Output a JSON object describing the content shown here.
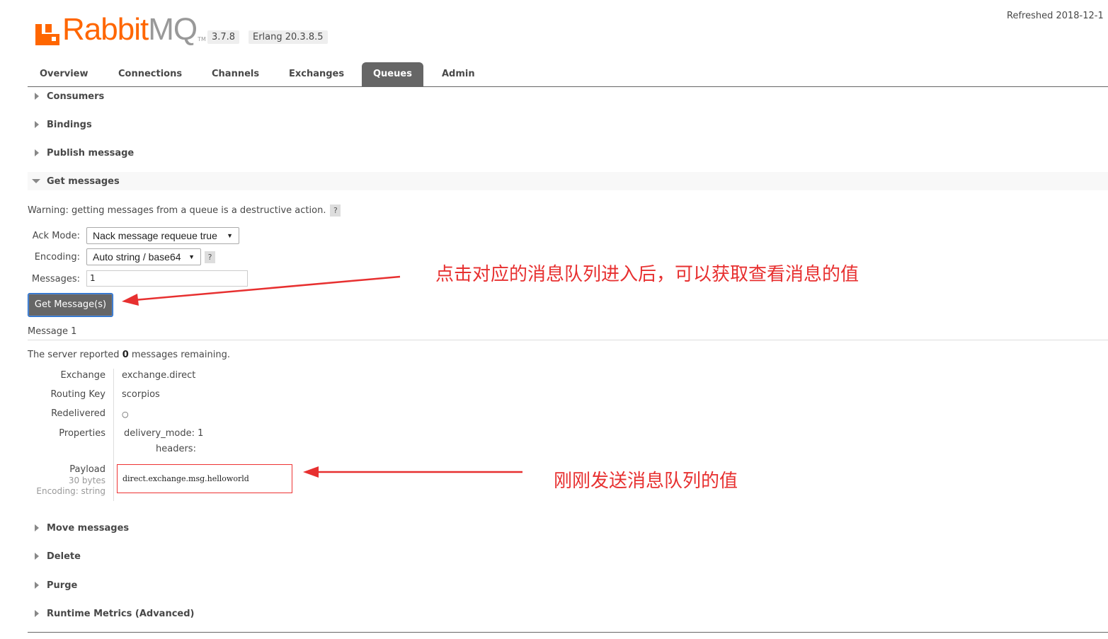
{
  "header": {
    "logo_rabbit": "Rabbit",
    "logo_mq": "MQ",
    "logo_tm": "TM",
    "version": "3.7.8",
    "erlang": "Erlang 20.3.8.5",
    "refreshed": "Refreshed 2018-12-1"
  },
  "tabs": [
    {
      "label": "Overview"
    },
    {
      "label": "Connections"
    },
    {
      "label": "Channels"
    },
    {
      "label": "Exchanges"
    },
    {
      "label": "Queues",
      "active": true
    },
    {
      "label": "Admin"
    }
  ],
  "sections_top": [
    {
      "label": "Consumers"
    },
    {
      "label": "Bindings"
    },
    {
      "label": "Publish message"
    }
  ],
  "get_messages": {
    "label": "Get messages",
    "warning": "Warning: getting messages from a queue is a destructive action.",
    "help": "?",
    "ack_mode_label": "Ack Mode:",
    "ack_mode_value": "Nack message requeue true",
    "encoding_label": "Encoding:",
    "encoding_value": "Auto string / base64",
    "messages_label": "Messages:",
    "messages_value": "1",
    "button": "Get Message(s)"
  },
  "result": {
    "title": "Message 1",
    "server_note_prefix": "The server reported ",
    "server_note_count": "0",
    "server_note_suffix": " messages remaining.",
    "exchange_key": "Exchange",
    "exchange_value": "exchange.direct",
    "routing_key_key": "Routing Key",
    "routing_key_value": "scorpios",
    "redelivered_key": "Redelivered",
    "redelivered_value": "○",
    "properties_key": "Properties",
    "delivery_mode_key": "delivery_mode:",
    "delivery_mode_value": "1",
    "headers_key": "headers:",
    "payload_key": "Payload",
    "payload_size": "30 bytes",
    "payload_encoding": "Encoding: string",
    "payload_value": "direct.exchange.msg.helloworld"
  },
  "sections_bottom": [
    {
      "label": "Move messages"
    },
    {
      "label": "Delete"
    },
    {
      "label": "Purge"
    },
    {
      "label": "Runtime Metrics (Advanced)"
    }
  ],
  "annotations": {
    "top": "点击对应的消息队列进入后，可以获取查看消息的值",
    "bottom": "刚刚发送消息队列的值"
  },
  "colors": {
    "brand": "#ff6600",
    "tab_active": "#666666",
    "annotation": "#e73030"
  }
}
